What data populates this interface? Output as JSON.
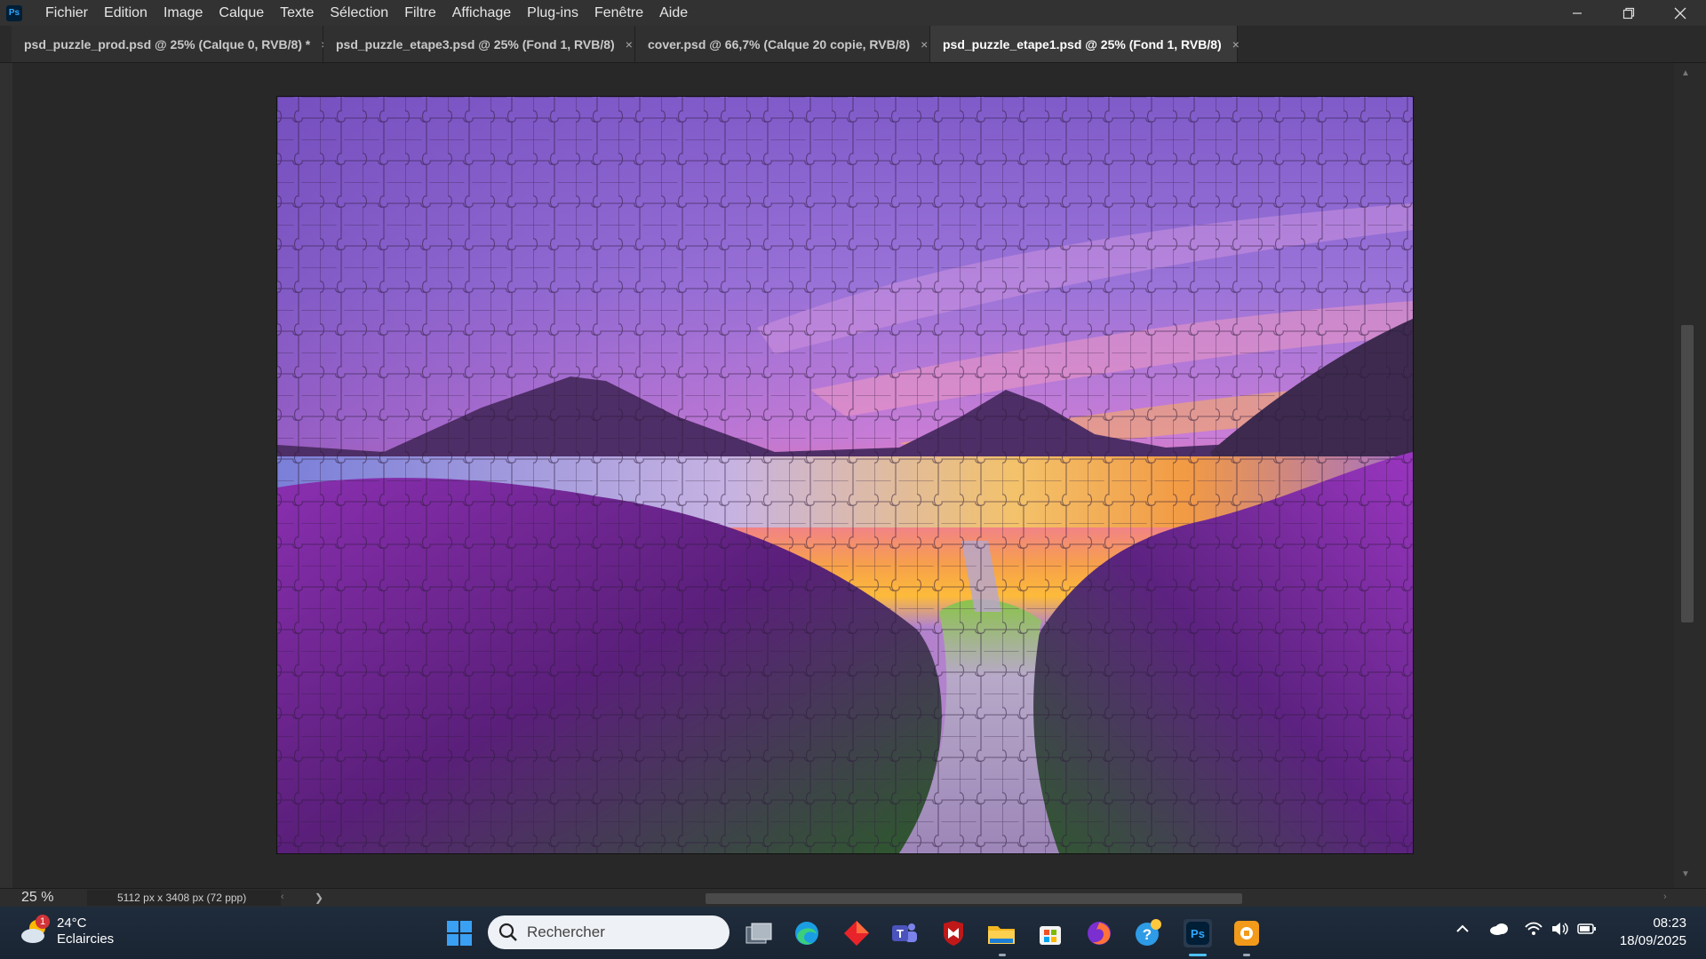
{
  "app": {
    "logo_text": "Ps"
  },
  "menu": [
    "Fichier",
    "Edition",
    "Image",
    "Calque",
    "Texte",
    "Sélection",
    "Filtre",
    "Affichage",
    "Plug-ins",
    "Fenêtre",
    "Aide"
  ],
  "tabs": [
    {
      "label": "psd_puzzle_prod.psd @ 25% (Calque 0, RVB/8) *",
      "active": false
    },
    {
      "label": "psd_puzzle_etape3.psd @ 25% (Fond 1, RVB/8)",
      "active": false
    },
    {
      "label": "cover.psd @ 66,7% (Calque 20 copie, RVB/8)",
      "active": false
    },
    {
      "label": "psd_puzzle_etape1.psd @ 25% (Fond 1, RVB/8)",
      "active": true
    }
  ],
  "status": {
    "zoom": "25 %",
    "doc_size": "5112 px x 3408 px (72 ppp)"
  },
  "taskbar": {
    "weather_temp": "24°C",
    "weather_desc": "Eclaircies",
    "weather_badge": "1",
    "search_placeholder": "Rechercher",
    "time": "08:23",
    "date": "18/09/2025"
  },
  "colors": {
    "menu_bg": "#323232",
    "workspace_bg": "#282828",
    "accent": "#31a8ff",
    "taskbar_bg": "#1d2a3a"
  },
  "icons": [
    "photoshop-logo",
    "minimize-icon",
    "restore-icon",
    "close-icon",
    "windows-start-icon",
    "search-icon",
    "task-view-icon",
    "edge-icon",
    "app-diamond-icon",
    "teams-icon",
    "mcafee-icon",
    "file-explorer-icon",
    "store-icon",
    "firefox-icon",
    "help-icon",
    "photoshop-taskbar-icon",
    "app-orange-icon",
    "chevron-up-icon",
    "onedrive-icon",
    "wifi-icon",
    "volume-icon",
    "battery-icon"
  ]
}
